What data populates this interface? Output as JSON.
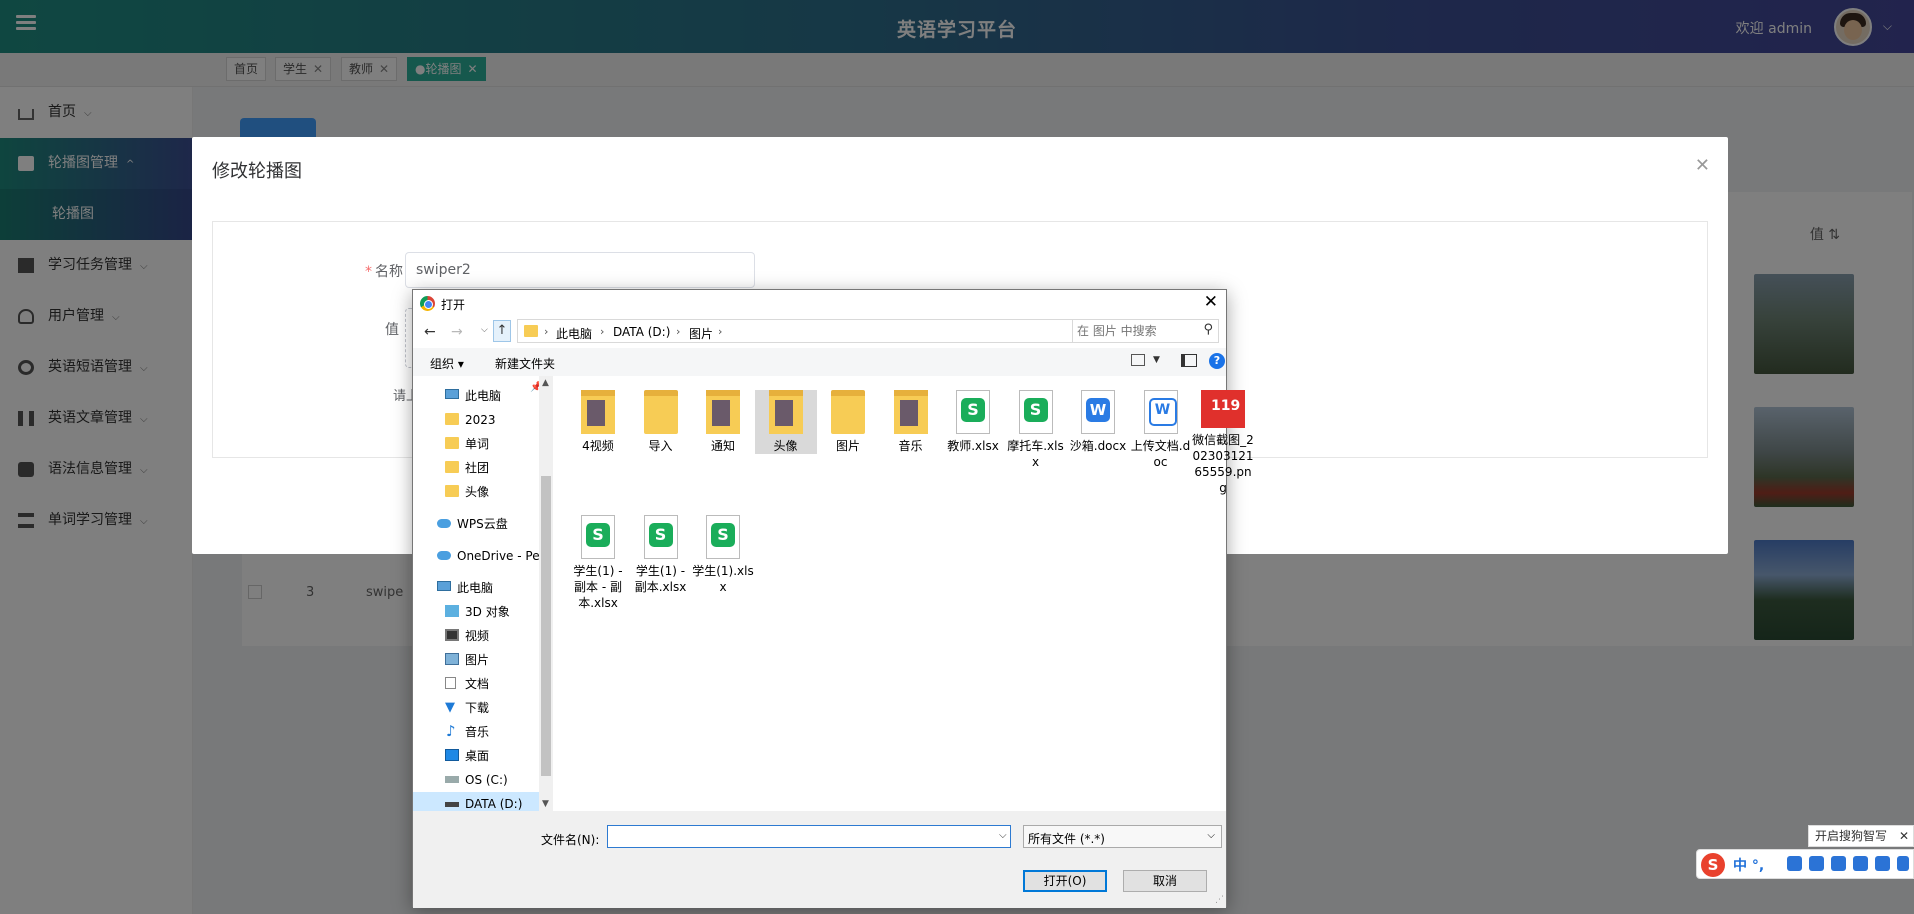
{
  "app": {
    "title": "英语学习平台",
    "welcome": "欢迎 admin"
  },
  "tabs": [
    {
      "label": "首页",
      "closable": false,
      "active": false
    },
    {
      "label": "学生",
      "closable": true,
      "active": false
    },
    {
      "label": "教师",
      "closable": true,
      "active": false
    },
    {
      "label": "●轮播图",
      "closable": true,
      "active": true
    }
  ],
  "tab_close_glyph": "✕",
  "sidebar": {
    "items": [
      {
        "label": "首页",
        "icon": "home-icon"
      },
      {
        "label": "轮播图管理",
        "icon": "gift-icon",
        "open": true
      },
      {
        "label": "学习任务管理",
        "icon": "task-icon"
      },
      {
        "label": "用户管理",
        "icon": "user-icon"
      },
      {
        "label": "英语短语管理",
        "icon": "gear-icon"
      },
      {
        "label": "英语文章管理",
        "icon": "book-icon"
      },
      {
        "label": "语法信息管理",
        "icon": "mail-icon"
      },
      {
        "label": "单词学习管理",
        "icon": "list-icon"
      }
    ],
    "sub_item": "轮播图",
    "caret_down": "⌵",
    "caret_up": "^"
  },
  "background_table": {
    "column_value": "值 ⇅",
    "row3_index": "3",
    "row3_name": "swipe"
  },
  "modal": {
    "title": "修改轮播图",
    "close_glyph": "✕",
    "name_label": "名称",
    "required_mark": "*",
    "name_value": "swiper2",
    "value_label": "值",
    "hint_prefix": "请上"
  },
  "dialog": {
    "title": "打开",
    "close_glyph": "✕",
    "breadcrumb": [
      "此电脑",
      "DATA (D:)",
      "图片"
    ],
    "search_placeholder": "在 图片 中搜索",
    "toolbar": {
      "organize": "组织 ▾",
      "new_folder": "新建文件夹",
      "help": "?"
    },
    "nav_glyphs": {
      "back": "←",
      "forward": "→",
      "recent": "⌵",
      "up": "↑",
      "refresh": "↻",
      "dropdown": "⌵"
    },
    "tree": [
      {
        "label": "此电脑",
        "icon": "pc",
        "indent": 1
      },
      {
        "label": "2023",
        "icon": "folder",
        "indent": 1
      },
      {
        "label": "单词",
        "icon": "folder",
        "indent": 1
      },
      {
        "label": "社团",
        "icon": "folder",
        "indent": 1
      },
      {
        "label": "头像",
        "icon": "folder",
        "indent": 1
      },
      {
        "label": "WPS云盘",
        "icon": "cloud",
        "indent": 0
      },
      {
        "label": "OneDrive - Perso",
        "icon": "cloud",
        "indent": 0
      },
      {
        "label": "此电脑",
        "icon": "pc",
        "indent": 0
      },
      {
        "label": "3D 对象",
        "icon": "cube",
        "indent": 1
      },
      {
        "label": "视频",
        "icon": "video",
        "indent": 1
      },
      {
        "label": "图片",
        "icon": "pic",
        "indent": 1
      },
      {
        "label": "文档",
        "icon": "doc",
        "indent": 1
      },
      {
        "label": "下载",
        "icon": "down",
        "indent": 1
      },
      {
        "label": "音乐",
        "icon": "music",
        "indent": 1
      },
      {
        "label": "桌面",
        "icon": "desk",
        "indent": 1
      },
      {
        "label": "OS (C:)",
        "icon": "drive",
        "indent": 1
      },
      {
        "label": "DATA (D:)",
        "icon": "drive-dark",
        "indent": 1,
        "selected": true
      }
    ],
    "files": [
      {
        "name": "4视频",
        "type": "folder-pic"
      },
      {
        "name": "导入",
        "type": "folder"
      },
      {
        "name": "通知",
        "type": "folder-pic"
      },
      {
        "name": "头像",
        "type": "folder-pic",
        "selected": true
      },
      {
        "name": "图片",
        "type": "folder"
      },
      {
        "name": "音乐",
        "type": "folder-pic"
      },
      {
        "name": "教师.xlsx",
        "type": "xlsx"
      },
      {
        "name": "摩托车.xlsx",
        "type": "xlsx"
      },
      {
        "name": "沙箱.docx",
        "type": "docx"
      },
      {
        "name": "上传文档.doc",
        "type": "doc"
      },
      {
        "name": "微信截图_20230312165559.png",
        "type": "png"
      },
      {
        "name": "学生(1) - 副本 - 副本.xlsx",
        "type": "xlsx"
      },
      {
        "name": "学生(1) - 副本.xlsx",
        "type": "xlsx"
      },
      {
        "name": "学生(1).xlsx",
        "type": "xlsx"
      }
    ],
    "filename_label": "文件名(N):",
    "filename_value": "",
    "filter_value": "所有文件 (*.*)",
    "open_button": "打开(O)",
    "cancel_button": "取消"
  },
  "ime": {
    "tip": "开启搜狗智写",
    "tip_close": "✕",
    "logo": "S",
    "mode": "中 °,"
  }
}
